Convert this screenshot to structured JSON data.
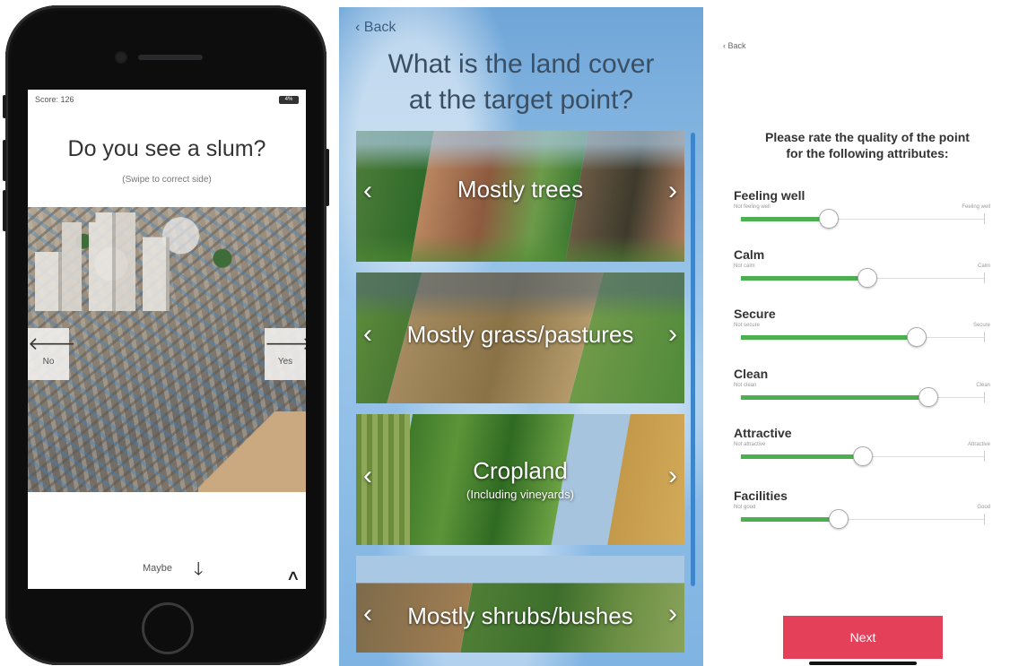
{
  "slum_screen": {
    "score": "Score: 126",
    "battery": "4%",
    "question": "Do you see a slum?",
    "hint": "(Swipe to correct side)",
    "no_label": "No",
    "yes_label": "Yes",
    "maybe_label": "Maybe",
    "icons": [
      "arrow-left-icon",
      "arrow-right-icon",
      "arrow-down-icon",
      "chevron-up-icon"
    ]
  },
  "land_cover_screen": {
    "back_label": "Back",
    "question_line1": "What is the land cover",
    "question_line2": "at the target point?",
    "options": [
      {
        "label": "Mostly trees",
        "sub": ""
      },
      {
        "label": "Mostly grass/pastures",
        "sub": ""
      },
      {
        "label": "Cropland",
        "sub": "(Including vineyards)"
      },
      {
        "label": "Mostly shrubs/bushes",
        "sub": ""
      }
    ]
  },
  "rating_screen": {
    "back_label": "Back",
    "prompt_line1": "Please rate the quality of the point",
    "prompt_line2": "for the following attributes:",
    "attributes": [
      {
        "name": "Feeling well",
        "low": "Not feeling well",
        "high": "Feeling well",
        "value": 0.36
      },
      {
        "name": "Calm",
        "low": "Not calm",
        "high": "Calm",
        "value": 0.52
      },
      {
        "name": "Secure",
        "low": "Not secure",
        "high": "Secure",
        "value": 0.72
      },
      {
        "name": "Clean",
        "low": "Not clean",
        "high": "Clean",
        "value": 0.77
      },
      {
        "name": "Attractive",
        "low": "Not attractive",
        "high": "Attractive",
        "value": 0.5
      },
      {
        "name": "Facilities",
        "low": "Not good",
        "high": "Good",
        "value": 0.4
      }
    ],
    "next_label": "Next",
    "accent_color": "#4caf50",
    "button_color": "#e4405a"
  }
}
